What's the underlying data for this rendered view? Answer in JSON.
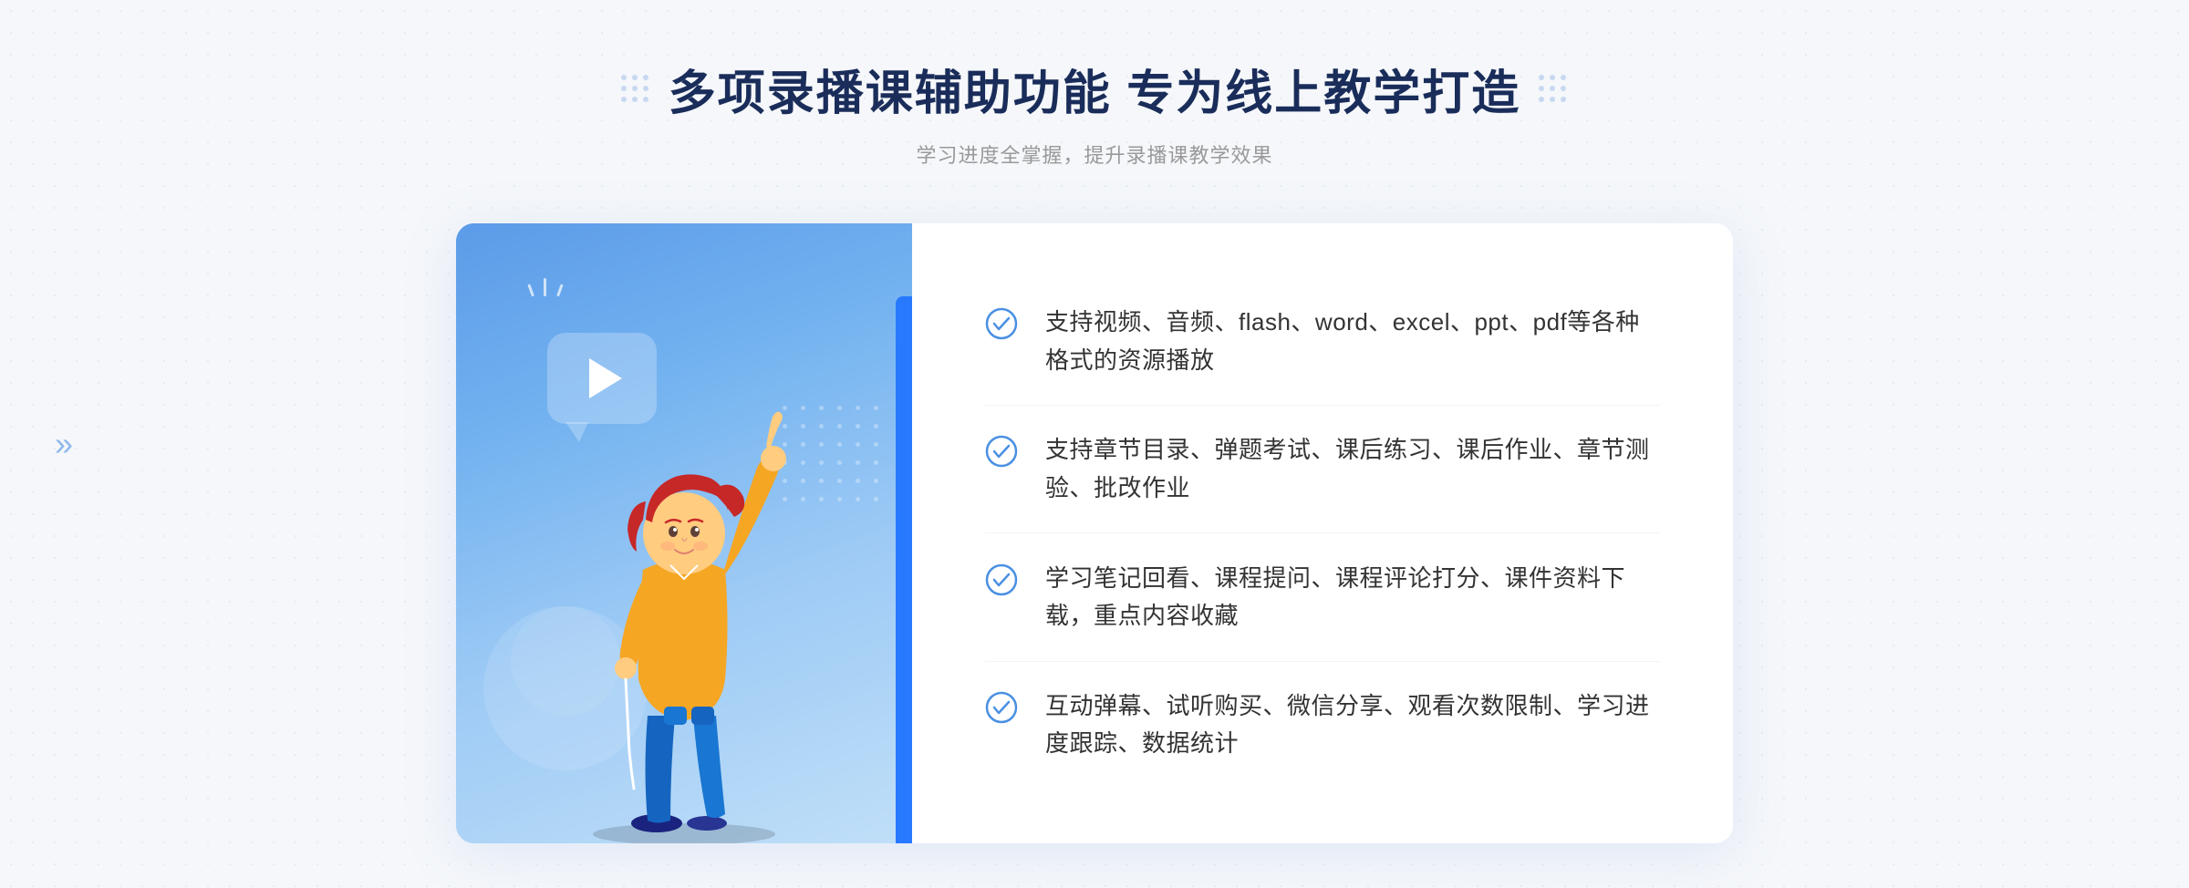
{
  "page": {
    "background": "#f5f7fa"
  },
  "header": {
    "main_title": "多项录播课辅助功能 专为线上教学打造",
    "subtitle": "学习进度全掌握，提升录播课教学效果"
  },
  "features": [
    {
      "id": 1,
      "text": "支持视频、音频、flash、word、excel、ppt、pdf等各种格式的资源播放"
    },
    {
      "id": 2,
      "text": "支持章节目录、弹题考试、课后练习、课后作业、章节测验、批改作业"
    },
    {
      "id": 3,
      "text": "学习笔记回看、课程提问、课程评论打分、课件资料下载，重点内容收藏"
    },
    {
      "id": 4,
      "text": "互动弹幕、试听购买、微信分享、观看次数限制、学习进度跟踪、数据统计"
    }
  ],
  "decorative": {
    "left_chevrons": "»",
    "dot_grid_size": 9
  }
}
